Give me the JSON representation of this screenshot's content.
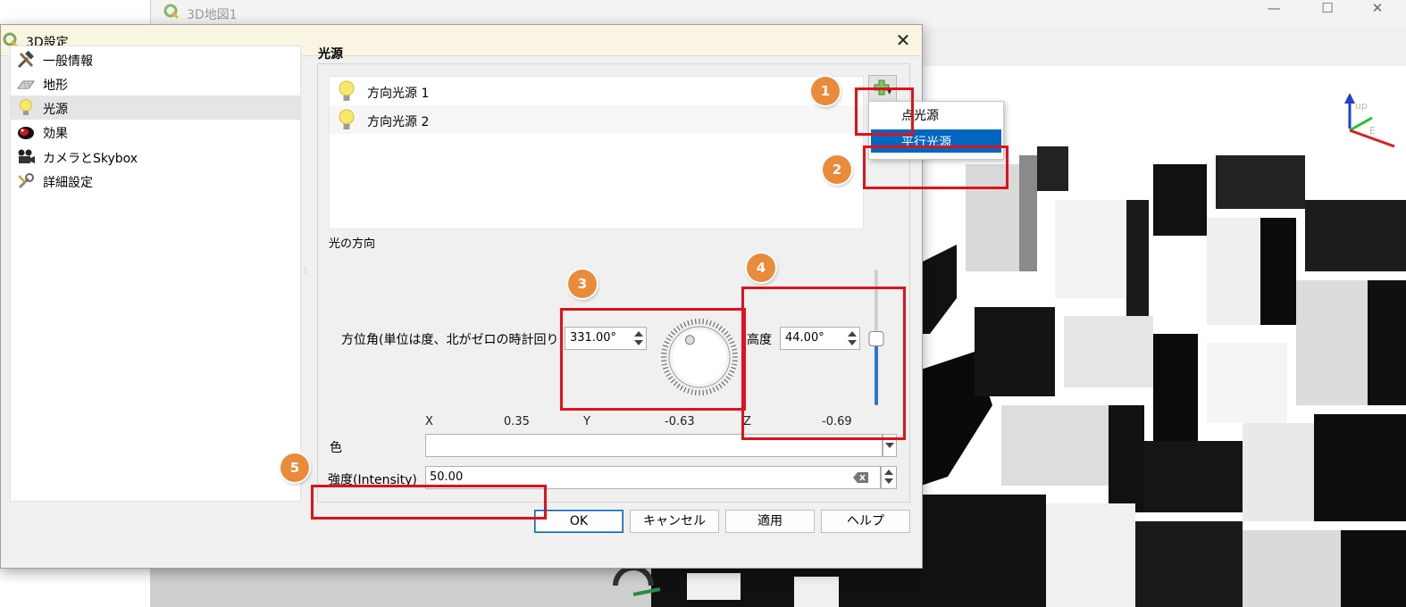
{
  "main_window": {
    "title": "3D地図1",
    "controls": [
      "—",
      "☐",
      "✕"
    ],
    "axis_labels": [
      "up",
      "E"
    ]
  },
  "dialog": {
    "title": "3D設定",
    "close": "✕",
    "nav": [
      {
        "label": "一般情報",
        "icon": "hammer-wrench-icon"
      },
      {
        "label": "地形",
        "icon": "terrain-icon"
      },
      {
        "label": "光源",
        "icon": "lightbulb-icon",
        "selected": true
      },
      {
        "label": "効果",
        "icon": "effects-icon"
      },
      {
        "label": "カメラとSkybox",
        "icon": "camera-icon"
      },
      {
        "label": "詳細設定",
        "icon": "advanced-settings-icon"
      }
    ],
    "lights": {
      "section_title": "光源",
      "items": [
        "方向光源 1",
        "方向光源 2"
      ],
      "add_menu": [
        "点光源",
        "平行光源"
      ],
      "selected_menu_item": "平行光源",
      "direction_label": "光の方向",
      "azimuth_label": "方位角(単位は度、北がゼロの時計回り)",
      "azimuth_value": "331.00°",
      "altitude_label": "高度",
      "altitude_value": "44.00°",
      "altitude_fraction": 0.49,
      "x_label": "X",
      "x_value": "0.35",
      "y_label": "Y",
      "y_value": "-0.63",
      "z_label": "Z",
      "z_value": "-0.69",
      "color_label": "色",
      "intensity_label": "強度(Intensity)",
      "intensity_value": "50.00"
    },
    "buttons": {
      "ok": "OK",
      "cancel": "キャンセル",
      "apply": "適用",
      "help": "ヘルプ"
    }
  },
  "annotations": [
    "1",
    "2",
    "3",
    "4",
    "5"
  ],
  "colors": {
    "highlight": "#e0111b",
    "badge": "#e98b3a",
    "selection": "#0067c0"
  }
}
